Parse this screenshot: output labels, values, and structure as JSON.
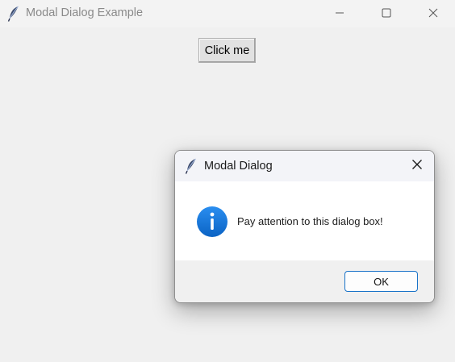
{
  "main_window": {
    "title": "Modal Dialog Example",
    "app_icon": "feather-icon",
    "controls": {
      "minimize_icon": "minimize-icon",
      "maximize_icon": "maximize-icon",
      "close_icon": "close-icon"
    },
    "click_button_label": "Click me"
  },
  "dialog": {
    "title": "Modal Dialog",
    "app_icon": "feather-icon",
    "close_icon": "close-icon",
    "message_icon": "info-icon",
    "message": "Pay attention to this dialog box!",
    "ok_label": "OK"
  },
  "colors": {
    "window_bg": "#f0f0f0",
    "info_blue": "#0a6fd1",
    "ok_border": "#1a73c8"
  }
}
